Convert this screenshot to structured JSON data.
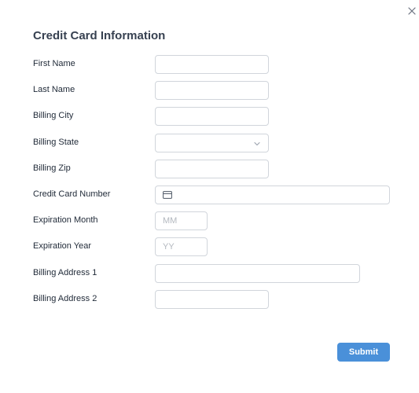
{
  "dialog": {
    "title": "Credit Card Information",
    "close_icon": "close-icon"
  },
  "form": {
    "first_name": {
      "label": "First Name",
      "value": "",
      "placeholder": ""
    },
    "last_name": {
      "label": "Last Name",
      "value": "",
      "placeholder": ""
    },
    "billing_city": {
      "label": "Billing City",
      "value": "",
      "placeholder": ""
    },
    "billing_state": {
      "label": "Billing State",
      "selected": "",
      "icon": "chevron-down-icon"
    },
    "billing_zip": {
      "label": "Billing Zip",
      "value": "",
      "placeholder": ""
    },
    "card_number": {
      "label": "Credit Card Number",
      "value": "",
      "placeholder": "",
      "icon": "credit-card-icon"
    },
    "expiration_month": {
      "label": "Expiration Month",
      "value": "",
      "placeholder": "MM"
    },
    "expiration_year": {
      "label": "Expiration Year",
      "value": "",
      "placeholder": "YY"
    },
    "billing_address_1": {
      "label": "Billing Address 1",
      "value": "",
      "placeholder": ""
    },
    "billing_address_2": {
      "label": "Billing Address 2",
      "value": "",
      "placeholder": ""
    }
  },
  "actions": {
    "submit_label": "Submit"
  },
  "colors": {
    "accent": "#4a90d9",
    "border": "#d1d5db",
    "title": "#374151",
    "placeholder": "#b3b8bf"
  }
}
